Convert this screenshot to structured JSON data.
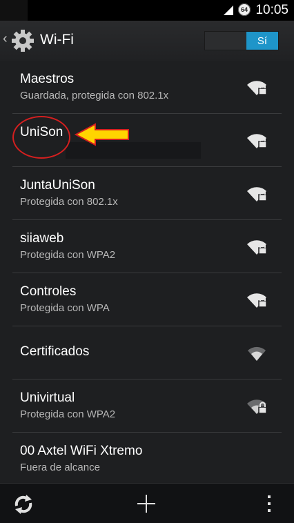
{
  "status_bar": {
    "time": "10:05",
    "badge": "64"
  },
  "header": {
    "title": "Wi-Fi",
    "toggle_label": "Sí"
  },
  "networks": [
    {
      "name": "Maestros",
      "status": "Guardada, protegida con 802.1x"
    },
    {
      "name": "UniSon",
      "status": ""
    },
    {
      "name": "JuntaUniSon",
      "status": "Protegida con 802.1x"
    },
    {
      "name": "siiaweb",
      "status": "Protegida con WPA2"
    },
    {
      "name": "Controles",
      "status": "Protegida con WPA"
    },
    {
      "name": "Certificados",
      "status": ""
    },
    {
      "name": "Univirtual",
      "status": "Protegida con WPA2"
    },
    {
      "name": "00 Axtel WiFi Xtremo",
      "status": "Fuera de alcance"
    }
  ],
  "colors": {
    "accent": "#1e95c9",
    "annotation": "#d41f1f",
    "arrow": "#ffd400"
  }
}
